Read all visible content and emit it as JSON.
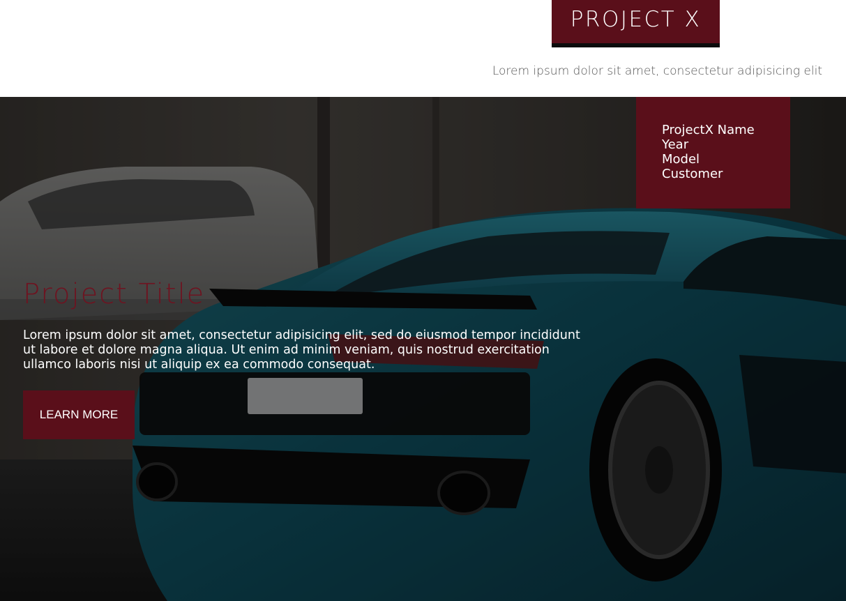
{
  "header": {
    "brand": "PROJECT X",
    "tagline": "Lorem ipsum dolor sit amet, consectetur adipisicing elit"
  },
  "info_card": {
    "lines": [
      "ProjectX Name",
      "Year",
      "Model",
      "Customer"
    ]
  },
  "hero": {
    "image_alt": "car-photo",
    "title": "Project Title",
    "description": "Lorem ipsum dolor sit amet, consectetur adipisicing elit, sed do eiusmod tempor incididunt ut labore et dolore magna aliqua. Ut enim ad minim veniam, quis nostrud exercitation ullamco laboris nisi ut aliquip ex ea commodo consequat.",
    "button_label": "LEARN MORE"
  },
  "colors": {
    "brand": "#5a0f1a",
    "title": "#6e1320",
    "tagline": "#555555"
  }
}
